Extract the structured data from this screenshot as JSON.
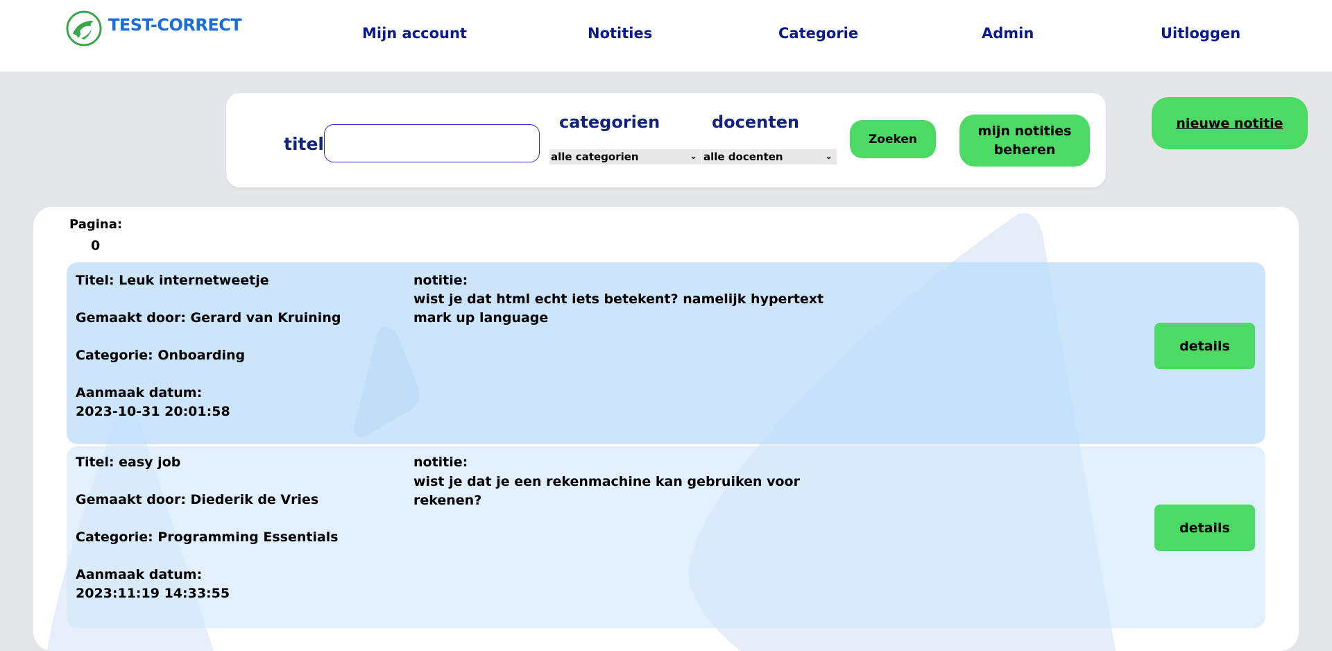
{
  "brand": {
    "name": "TEST-CORRECT",
    "logo_icon": "dolphin-logo-icon",
    "colors": {
      "brand_green": "#3aa64a",
      "brand_blue": "#1a6ed8"
    }
  },
  "nav": {
    "items": [
      {
        "label": "Mijn account"
      },
      {
        "label": "Notities"
      },
      {
        "label": "Categorie"
      },
      {
        "label": "Admin"
      },
      {
        "label": "Uitloggen"
      }
    ]
  },
  "search": {
    "titel_label": "titel",
    "titel_value": "",
    "categorien_label": "categorien",
    "categorien_selected": "alle categorien",
    "docenten_label": "docenten",
    "docenten_selected": "alle docenten",
    "zoeken_button": "Zoeken",
    "mijn_notities_button_line1": "mijn notities",
    "mijn_notities_button_line2": "beheren",
    "nieuwe_notitie_button": "nieuwe notitie"
  },
  "pagination": {
    "label": "Pagina:",
    "page": "0"
  },
  "notes": [
    {
      "titel": "Titel: Leuk internetweetje",
      "gemaakt_door": "Gemaakt door: Gerard van Kruining",
      "categorie": "Categorie: Onboarding",
      "aanmaak_label": "Aanmaak datum:",
      "aanmaak_datum": "2023-10-31 20:01:58",
      "notitie_label": "notitie:",
      "notitie_text": "wist je dat html echt iets betekent? namelijk hypertext mark up language",
      "details_button": "details"
    },
    {
      "titel": "Titel: easy job",
      "gemaakt_door": "Gemaakt door: Diederik de Vries",
      "categorie": "Categorie: Programming Essentials",
      "aanmaak_label": "Aanmaak datum:",
      "aanmaak_datum": "2023:11:19 14:33:55",
      "notitie_label": "notitie:",
      "notitie_text": "wist je dat je een rekenmachine kan gebruiken voor rekenen?",
      "details_button": "details"
    }
  ],
  "colors": {
    "accent_green": "#4cd964",
    "nav_text": "#0b1a8c",
    "page_bg": "#e4e6ea"
  }
}
